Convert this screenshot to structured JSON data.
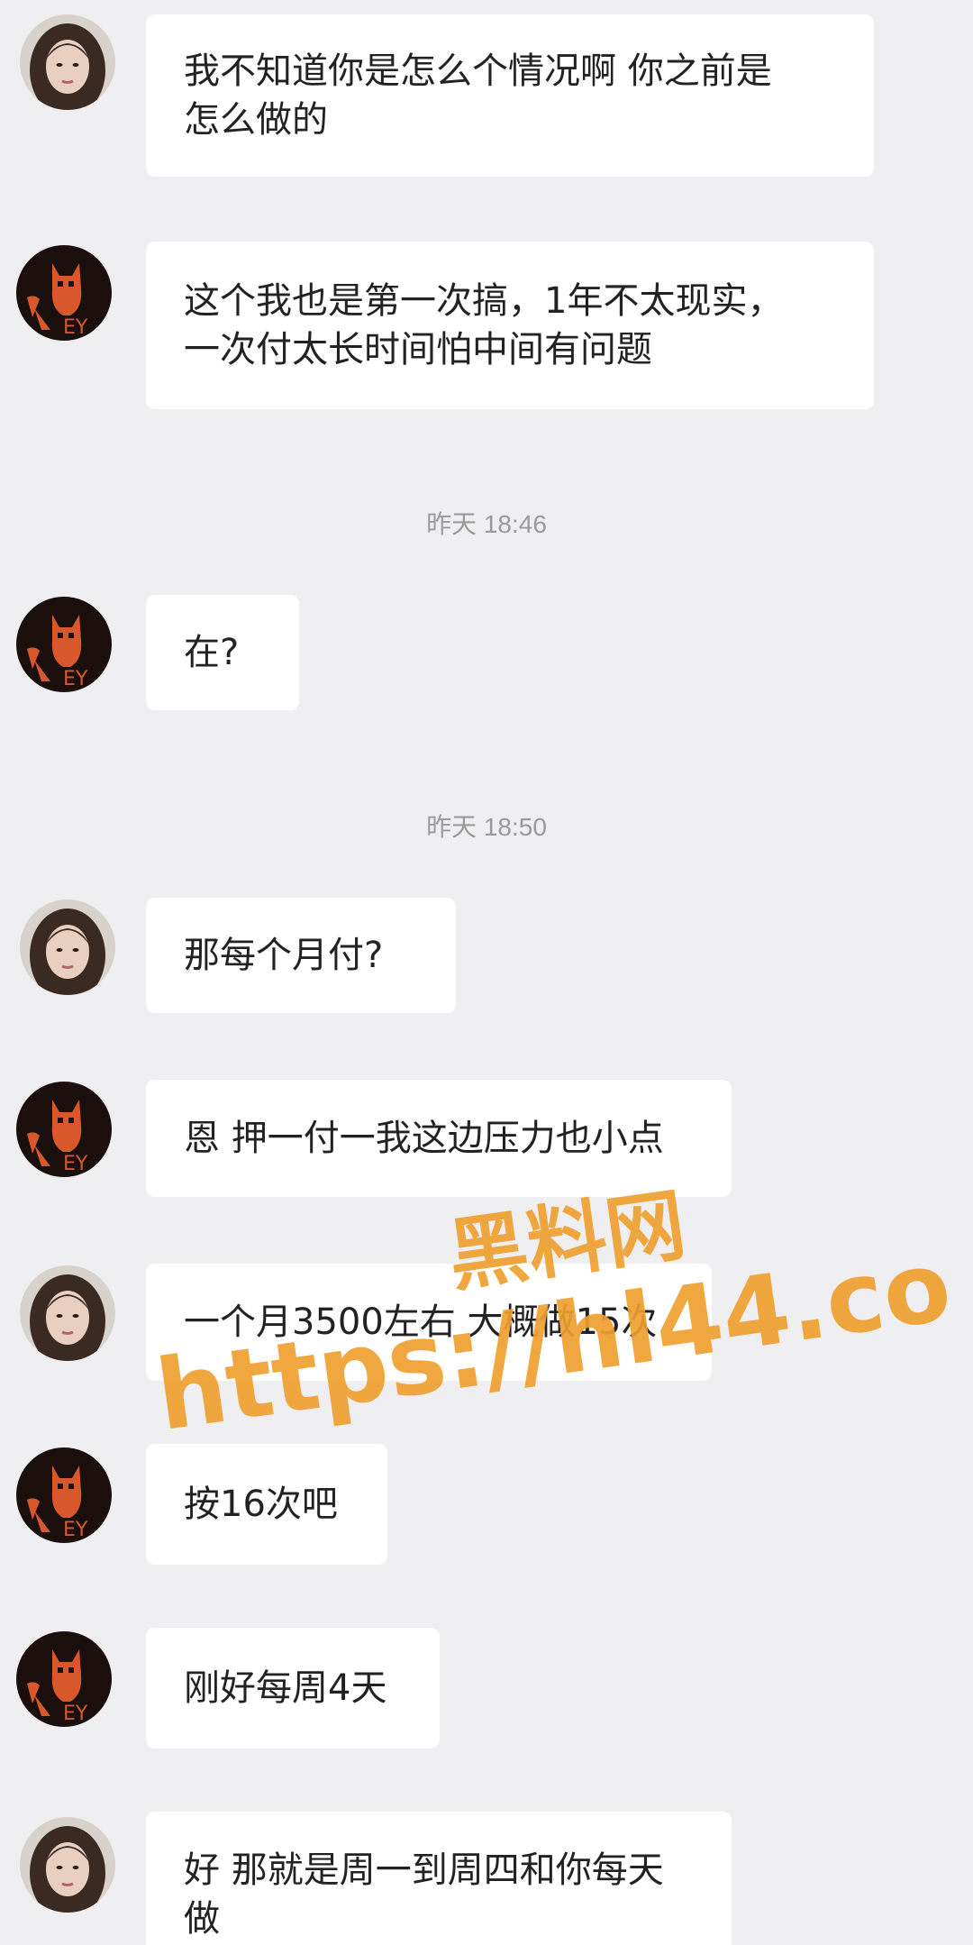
{
  "chat": {
    "messages": [
      {
        "sender": "girl",
        "text": "我不知道你是怎么个情况啊 你之前是\n怎么做的"
      },
      {
        "sender": "cat",
        "text": "这个我也是第一次搞，1年不太现实，\n一次付太长时间怕中间有问题"
      },
      {
        "type": "time",
        "text": "昨天 18:46"
      },
      {
        "sender": "cat",
        "text": "在?"
      },
      {
        "type": "time",
        "text": "昨天 18:50"
      },
      {
        "sender": "girl",
        "text": "那每个月付?"
      },
      {
        "sender": "cat",
        "text": "恩 押一付一我这边压力也小点"
      },
      {
        "sender": "girl",
        "text": "一个月3500左右 大概做15次"
      },
      {
        "sender": "cat",
        "text": "按16次吧"
      },
      {
        "sender": "cat",
        "text": "刚好每周4天"
      },
      {
        "sender": "girl",
        "text": "好 那就是周一到周四和你每天\n做"
      }
    ]
  },
  "watermark": {
    "line1": "黑料网",
    "line2": "https://hl44.co",
    "color": "#f0a030"
  },
  "colors": {
    "background": "#efeff1",
    "bubble": "#ffffff",
    "text": "#222222",
    "time": "#9a9a9a",
    "cat_avatar_bg": "#1a0f0c",
    "cat_avatar_accent": "#d9582b"
  },
  "avatars": {
    "girl": "woman-portrait-avatar",
    "cat": "orange-cat-logo-avatar"
  }
}
